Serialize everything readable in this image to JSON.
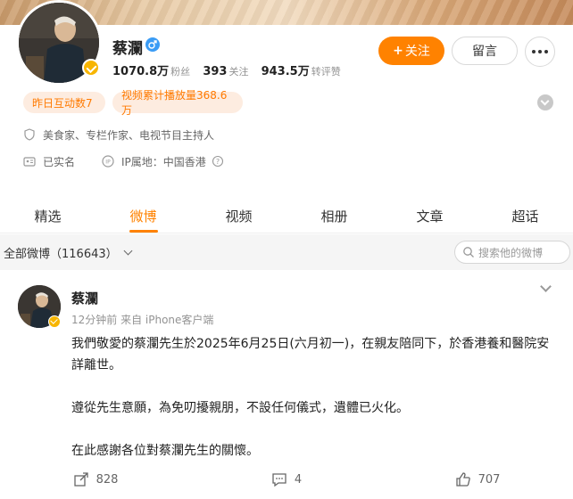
{
  "profile": {
    "name": "蔡瀾",
    "gender_icon": "male-symbol-icon",
    "stats": [
      {
        "value": "1070.8万",
        "label": "粉丝"
      },
      {
        "value": "393",
        "label": "关注"
      },
      {
        "value": "943.5万",
        "label": "转评赞"
      }
    ],
    "follow_label": "关注",
    "message_label": "留言",
    "pills": [
      "昨日互动数7",
      "视频累计播放量368.6万"
    ],
    "description": "美食家、专栏作家、电视节目主持人",
    "real_name": "已实名",
    "ip_location": "IP属地：中国香港"
  },
  "tabs": [
    "精选",
    "微博",
    "视频",
    "相册",
    "文章",
    "超话"
  ],
  "active_tab": "微博",
  "filter": {
    "label": "全部微博（116643）",
    "search_placeholder": "搜索他的微博"
  },
  "post": {
    "author": "蔡瀾",
    "meta": "12分钟前 来自 iPhone客户端",
    "paragraphs": [
      "我們敬愛的蔡瀾先生於2025年6月25日(六月初一)，在親友陪同下，於香港養和醫院安詳離世。",
      "遵從先生意願，為免叨擾親朋，不設任何儀式，遺體已火化。",
      "在此感謝各位對蔡瀾先生的關懷。"
    ],
    "repost_count": "828",
    "comment_count": "4",
    "like_count": "707"
  },
  "colors": {
    "accent": "#ff8200",
    "pill_bg": "#fdece0",
    "verified": "#f7b500"
  }
}
